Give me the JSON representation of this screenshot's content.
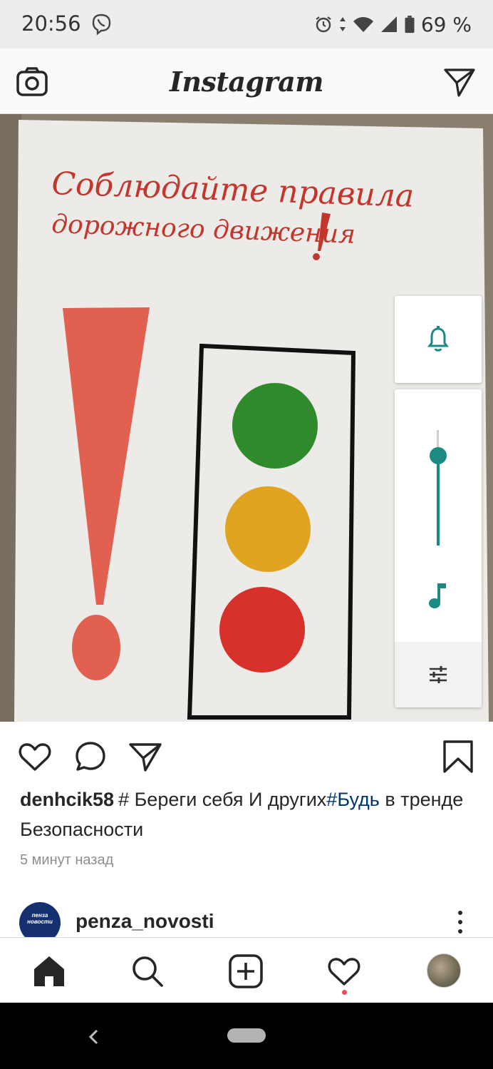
{
  "status_bar": {
    "time": "20:56",
    "battery": "69 %"
  },
  "header": {
    "logo": "Instagram"
  },
  "post": {
    "image_text_line1": "Соблюдайте правила",
    "image_text_line2": "дорожного движения",
    "username": "denhcik58",
    "caption_part1": "# Береги себя И других",
    "caption_hashtag": "#Будь",
    "caption_part2": " в тренде Безопасности",
    "time_ago": "5 минут назад"
  },
  "volume_panel": {
    "level": 0.78,
    "accent_color": "#1a8a83"
  },
  "next_post": {
    "username": "penza_novosti",
    "avatar_text": "пенза новости"
  },
  "colors": {
    "link": "#003569",
    "notification_dot": "#ed4956"
  }
}
